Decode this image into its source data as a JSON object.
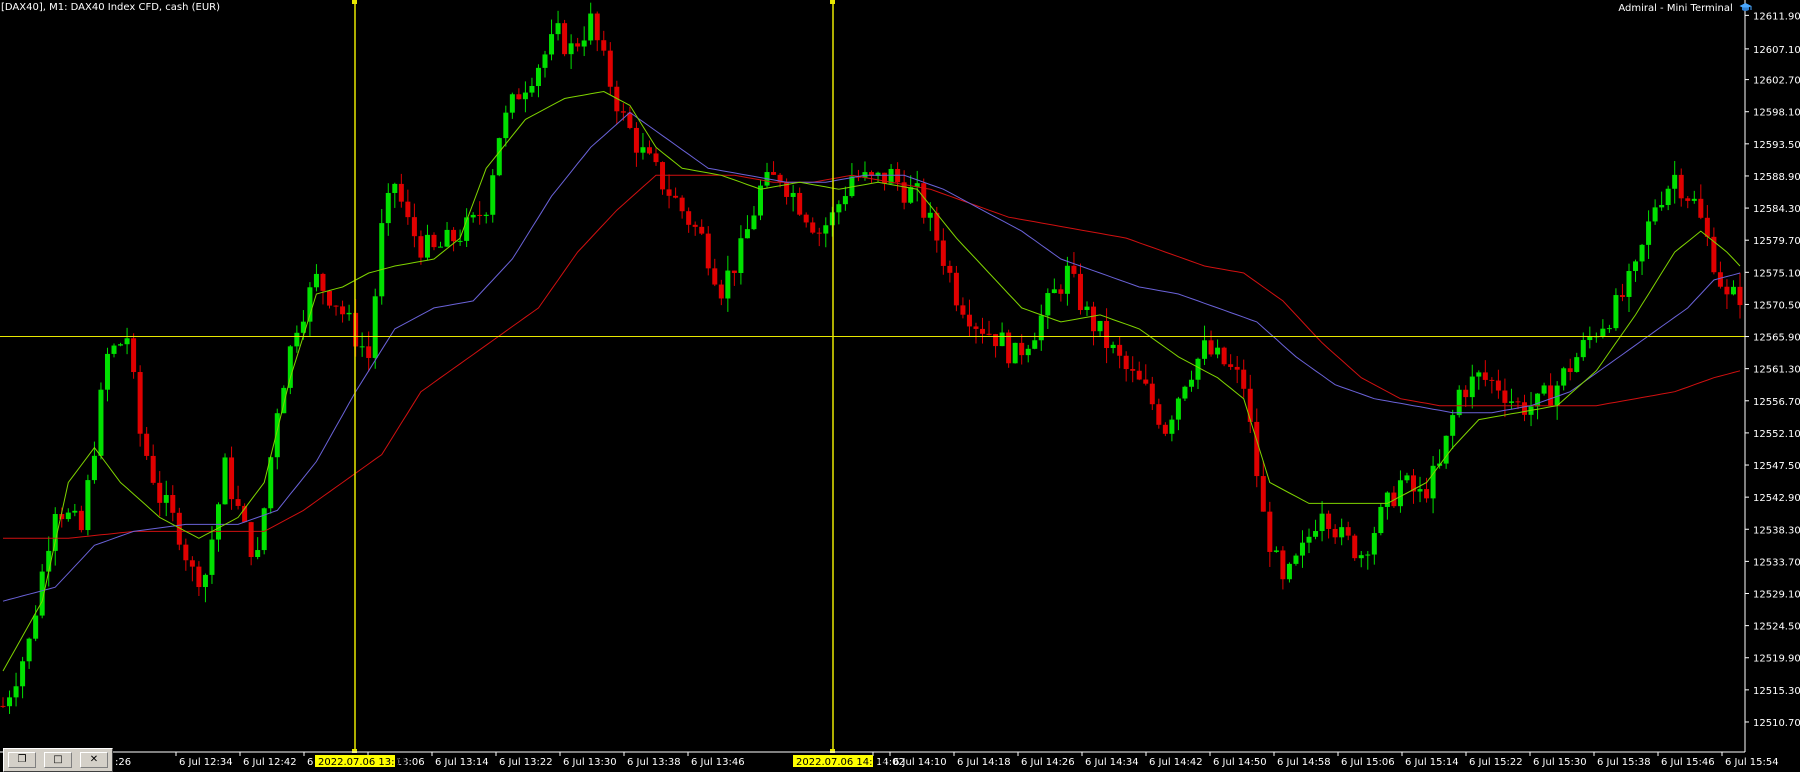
{
  "header": {
    "symbol_info": "[DAX40], M1:  DAX40 Index CFD, cash (EUR)",
    "terminal_title": "Admiral - Mini Terminal"
  },
  "colors": {
    "bg": "#000000",
    "axis": "#ffffff",
    "bull": "#00e000",
    "bear": "#e00000",
    "ma_fast": "#7fd400",
    "ma_mid": "#6a62d8",
    "ma_slow": "#d01010",
    "crosshair": "#e8e800",
    "time_tag": "#ffff00"
  },
  "chart_data": {
    "type": "candlestick",
    "title": "",
    "xlabel": "",
    "ylabel": "",
    "ylim": [
      12506.4,
      12614.1
    ],
    "y_ticks": [
      "12611.90",
      "12607.10",
      "12602.70",
      "12598.10",
      "12593.50",
      "12588.90",
      "12584.30",
      "12579.70",
      "12575.10",
      "12570.50",
      "12565.90",
      "12561.30",
      "12556.70",
      "12552.10",
      "12547.50",
      "12542.90",
      "12538.30",
      "12533.70",
      "12529.10",
      "12524.50",
      "12519.90",
      "12515.30",
      "12510.70"
    ],
    "x_ticks": [
      ":26",
      "6 Jul 12:34",
      "6 Jul 12:42",
      "6 Jul 12:5",
      "6 Jul 13:06",
      "6 Jul 13:14",
      "6 Jul 13:22",
      "6 Jul 13:30",
      "6 Jul 13:38",
      "6 Jul 13:46",
      "14:02",
      "6 Jul 14:10",
      "6 Jul 14:18",
      "6 Jul 14:26",
      "6 Jul 14:34",
      "6 Jul 14:42",
      "6 Jul 14:50",
      "6 Jul 14:58",
      "6 Jul 15:06",
      "6 Jul 15:14",
      "6 Jul 15:22",
      "6 Jul 15:30",
      "6 Jul 15:38",
      "6 Jul 15:46",
      "6 Jul 15:54"
    ],
    "crosshair_time_labels": [
      "2022.07.06 13:00",
      "2022.07.06 14:00"
    ],
    "horizontal_line_level": 12565.9,
    "ohlc_close_path": [
      [
        0,
        12513
      ],
      [
        4,
        12522
      ],
      [
        8,
        12542
      ],
      [
        12,
        12538
      ],
      [
        16,
        12563
      ],
      [
        19,
        12566
      ],
      [
        21,
        12552
      ],
      [
        24,
        12543
      ],
      [
        27,
        12538
      ],
      [
        29,
        12532
      ],
      [
        31,
        12532
      ],
      [
        34,
        12547
      ],
      [
        37,
        12538
      ],
      [
        39,
        12534
      ],
      [
        42,
        12556
      ],
      [
        45,
        12568
      ],
      [
        48,
        12574
      ],
      [
        51,
        12571
      ],
      [
        54,
        12566
      ],
      [
        56,
        12563
      ],
      [
        58,
        12581
      ],
      [
        60,
        12588
      ],
      [
        62,
        12582
      ],
      [
        64,
        12579
      ],
      [
        66,
        12578
      ],
      [
        69,
        12580
      ],
      [
        72,
        12582
      ],
      [
        74,
        12585
      ],
      [
        76,
        12595
      ],
      [
        79,
        12601
      ],
      [
        82,
        12605
      ],
      [
        85,
        12609
      ],
      [
        87,
        12607
      ],
      [
        90,
        12611
      ],
      [
        92,
        12605
      ],
      [
        95,
        12597
      ],
      [
        98,
        12592
      ],
      [
        101,
        12588
      ],
      [
        104,
        12584
      ],
      [
        107,
        12580
      ],
      [
        110,
        12573
      ],
      [
        113,
        12578
      ],
      [
        116,
        12587
      ],
      [
        119,
        12589
      ],
      [
        122,
        12585
      ],
      [
        125,
        12581
      ],
      [
        127,
        12583
      ],
      [
        130,
        12589
      ],
      [
        133,
        12588
      ],
      [
        136,
        12589
      ],
      [
        138,
        12587
      ],
      [
        140,
        12586
      ],
      [
        143,
        12580
      ],
      [
        146,
        12572
      ],
      [
        149,
        12568
      ],
      [
        152,
        12566
      ],
      [
        155,
        12563
      ],
      [
        158,
        12567
      ],
      [
        161,
        12572
      ],
      [
        163,
        12575
      ],
      [
        166,
        12569
      ],
      [
        169,
        12565
      ],
      [
        172,
        12561
      ],
      [
        175,
        12558
      ],
      [
        178,
        12553
      ],
      [
        181,
        12560
      ],
      [
        184,
        12564
      ],
      [
        187,
        12562
      ],
      [
        190,
        12559
      ],
      [
        193,
        12540
      ],
      [
        196,
        12530
      ],
      [
        199,
        12535
      ],
      [
        202,
        12542
      ],
      [
        205,
        12537
      ],
      [
        208,
        12535
      ],
      [
        211,
        12540
      ],
      [
        214,
        12545
      ],
      [
        217,
        12543
      ],
      [
        220,
        12547
      ],
      [
        223,
        12558
      ],
      [
        226,
        12560
      ],
      [
        229,
        12559
      ],
      [
        232,
        12556
      ],
      [
        235,
        12556
      ],
      [
        238,
        12559
      ],
      [
        241,
        12563
      ],
      [
        244,
        12567
      ],
      [
        247,
        12570
      ],
      [
        250,
        12575
      ],
      [
        253,
        12585
      ],
      [
        256,
        12589
      ],
      [
        259,
        12585
      ],
      [
        262,
        12577
      ],
      [
        264,
        12571
      ],
      [
        266,
        12572
      ]
    ],
    "ma_fast": [
      [
        0,
        12518
      ],
      [
        6,
        12528
      ],
      [
        10,
        12545
      ],
      [
        14,
        12550
      ],
      [
        18,
        12545
      ],
      [
        24,
        12540
      ],
      [
        30,
        12537
      ],
      [
        36,
        12540
      ],
      [
        40,
        12545
      ],
      [
        44,
        12560
      ],
      [
        48,
        12572
      ],
      [
        52,
        12573
      ],
      [
        56,
        12575
      ],
      [
        60,
        12576
      ],
      [
        66,
        12577
      ],
      [
        70,
        12580
      ],
      [
        74,
        12590
      ],
      [
        80,
        12597
      ],
      [
        86,
        12600
      ],
      [
        92,
        12601
      ],
      [
        96,
        12599
      ],
      [
        100,
        12593
      ],
      [
        104,
        12590
      ],
      [
        110,
        12589
      ],
      [
        116,
        12587
      ],
      [
        122,
        12588
      ],
      [
        128,
        12587
      ],
      [
        134,
        12588
      ],
      [
        140,
        12587
      ],
      [
        146,
        12580
      ],
      [
        150,
        12576
      ],
      [
        156,
        12570
      ],
      [
        162,
        12568
      ],
      [
        168,
        12569
      ],
      [
        174,
        12567
      ],
      [
        180,
        12563
      ],
      [
        186,
        12560
      ],
      [
        190,
        12557
      ],
      [
        194,
        12545
      ],
      [
        200,
        12542
      ],
      [
        206,
        12542
      ],
      [
        212,
        12542
      ],
      [
        218,
        12545
      ],
      [
        222,
        12550
      ],
      [
        226,
        12554
      ],
      [
        232,
        12555
      ],
      [
        238,
        12556
      ],
      [
        244,
        12561
      ],
      [
        250,
        12569
      ],
      [
        256,
        12578
      ],
      [
        260,
        12581
      ],
      [
        264,
        12578
      ],
      [
        266,
        12576
      ]
    ],
    "ma_mid": [
      [
        0,
        12528
      ],
      [
        8,
        12530
      ],
      [
        14,
        12536
      ],
      [
        20,
        12538
      ],
      [
        28,
        12539
      ],
      [
        36,
        12539
      ],
      [
        42,
        12541
      ],
      [
        48,
        12548
      ],
      [
        54,
        12558
      ],
      [
        60,
        12567
      ],
      [
        66,
        12570
      ],
      [
        72,
        12571
      ],
      [
        78,
        12577
      ],
      [
        84,
        12586
      ],
      [
        90,
        12593
      ],
      [
        96,
        12598
      ],
      [
        102,
        12594
      ],
      [
        108,
        12590
      ],
      [
        114,
        12589
      ],
      [
        120,
        12588
      ],
      [
        126,
        12588
      ],
      [
        132,
        12589
      ],
      [
        138,
        12589
      ],
      [
        144,
        12587
      ],
      [
        150,
        12584
      ],
      [
        156,
        12581
      ],
      [
        162,
        12577
      ],
      [
        168,
        12575
      ],
      [
        174,
        12573
      ],
      [
        180,
        12572
      ],
      [
        186,
        12570
      ],
      [
        192,
        12568
      ],
      [
        198,
        12563
      ],
      [
        204,
        12559
      ],
      [
        210,
        12557
      ],
      [
        216,
        12556
      ],
      [
        222,
        12555
      ],
      [
        228,
        12555
      ],
      [
        234,
        12556
      ],
      [
        240,
        12558
      ],
      [
        246,
        12562
      ],
      [
        252,
        12566
      ],
      [
        258,
        12570
      ],
      [
        262,
        12574
      ],
      [
        266,
        12575
      ]
    ],
    "ma_slow": [
      [
        0,
        12537
      ],
      [
        10,
        12537
      ],
      [
        20,
        12538
      ],
      [
        30,
        12538
      ],
      [
        40,
        12538
      ],
      [
        46,
        12541
      ],
      [
        52,
        12545
      ],
      [
        58,
        12549
      ],
      [
        64,
        12558
      ],
      [
        70,
        12562
      ],
      [
        76,
        12566
      ],
      [
        82,
        12570
      ],
      [
        88,
        12578
      ],
      [
        94,
        12584
      ],
      [
        100,
        12589
      ],
      [
        106,
        12589
      ],
      [
        112,
        12589
      ],
      [
        118,
        12588
      ],
      [
        124,
        12588
      ],
      [
        130,
        12589
      ],
      [
        136,
        12588
      ],
      [
        142,
        12587
      ],
      [
        148,
        12585
      ],
      [
        154,
        12583
      ],
      [
        160,
        12582
      ],
      [
        166,
        12581
      ],
      [
        172,
        12580
      ],
      [
        178,
        12578
      ],
      [
        184,
        12576
      ],
      [
        190,
        12575
      ],
      [
        196,
        12571
      ],
      [
        202,
        12565
      ],
      [
        208,
        12560
      ],
      [
        214,
        12557
      ],
      [
        220,
        12556
      ],
      [
        226,
        12556
      ],
      [
        232,
        12556
      ],
      [
        238,
        12556
      ],
      [
        244,
        12556
      ],
      [
        250,
        12557
      ],
      [
        256,
        12558
      ],
      [
        262,
        12560
      ],
      [
        266,
        12561
      ]
    ]
  }
}
